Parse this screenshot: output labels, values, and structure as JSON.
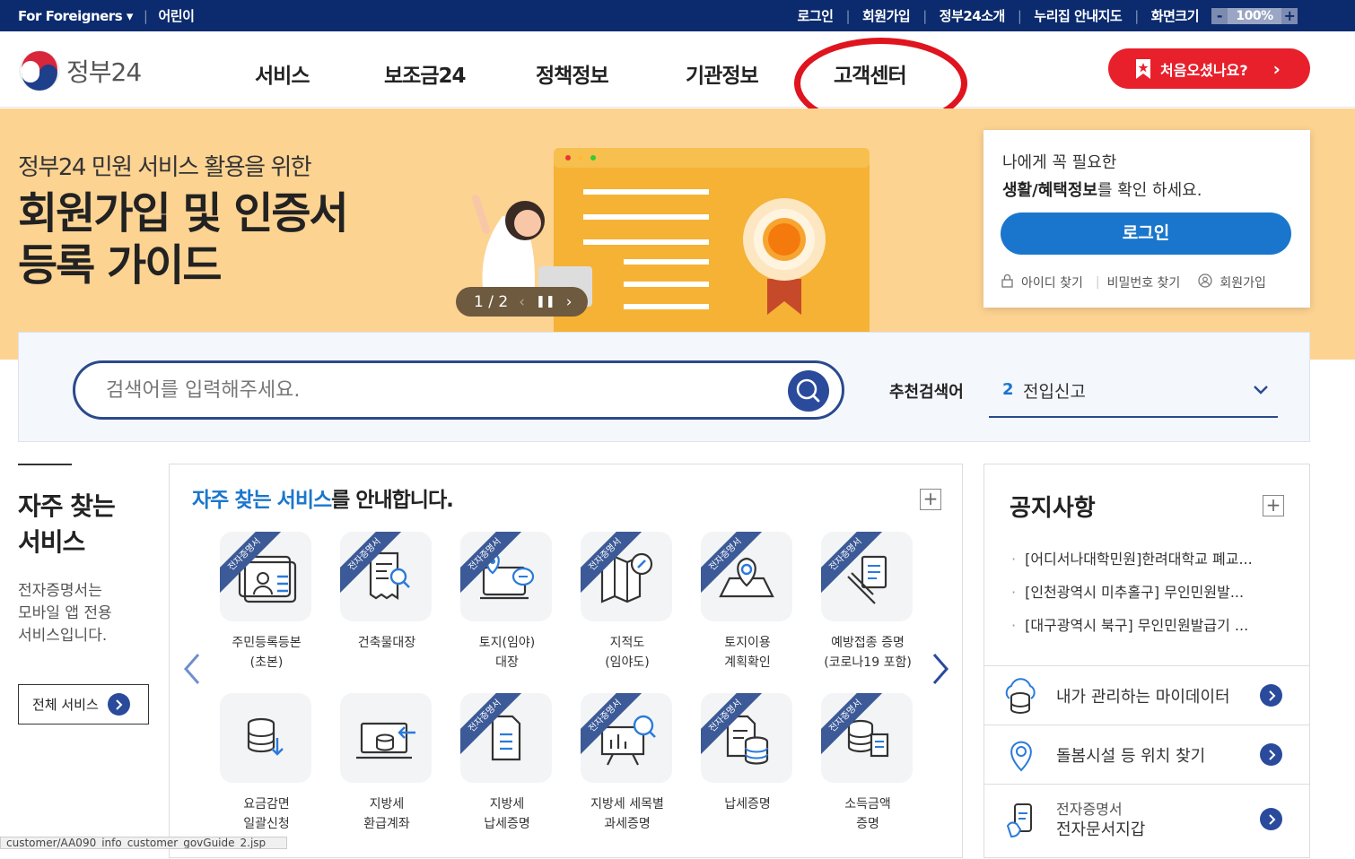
{
  "topbar": {
    "foreigners": "For Foreigners",
    "kids": "어린이",
    "login": "로그인",
    "signup": "회원가입",
    "intro": "정부24소개",
    "nurizip": "누리집 안내지도",
    "screen_size": "화면크기",
    "zoom_minus": "-",
    "zoom_value": "100%",
    "zoom_plus": "+"
  },
  "header": {
    "logo_text": "정부24",
    "nav": [
      "서비스",
      "보조금24",
      "정책정보",
      "기관정보",
      "고객센터"
    ],
    "first_visit": "처음오셨나요?"
  },
  "banner": {
    "subtitle": "정부24 민원 서비스 활용을 위한",
    "title_line1": "회원가입 및 인증서",
    "title_line2": "등록 가이드",
    "pager": "1 / 2"
  },
  "loginbox": {
    "line1": "나에게 꼭 필요한",
    "line2_bold": "생활/혜택정보",
    "line2_rest": "를 확인 하세요.",
    "login_button": "로그인",
    "find_id": "아이디 찾기",
    "find_pw": "비밀번호 찾기",
    "signup": "회원가입"
  },
  "search": {
    "placeholder": "검색어를 입력해주세요.",
    "recommend_label": "추천검색어",
    "recommend_num": "2",
    "recommend_text": "전입신고"
  },
  "frequent": {
    "title_line1": "자주 찾는",
    "title_line2": "서비스",
    "desc_line1": "전자증명서는",
    "desc_line2": "모바일 앱 전용",
    "desc_line3": "서비스입니다.",
    "all_services": "전체 서비스"
  },
  "services": {
    "head_highlight": "자주 찾는 서비스",
    "head_rest": "를 안내합니다.",
    "ribbon": "전자증명서",
    "row1": [
      {
        "l1": "주민등록등본",
        "l2": "(초본)",
        "icon": "id-card-icon"
      },
      {
        "l1": "건축물대장",
        "l2": "",
        "icon": "document-search-icon"
      },
      {
        "l1": "토지(임야)",
        "l2": "대장",
        "icon": "map-pin-chat-icon"
      },
      {
        "l1": "지적도",
        "l2": "(임야도)",
        "icon": "map-compass-icon"
      },
      {
        "l1": "토지이용",
        "l2": "계획확인",
        "icon": "land-pin-icon"
      },
      {
        "l1": "예방접종 증명",
        "l2": "(코로나19 포함)",
        "icon": "vaccine-icon"
      }
    ],
    "row2": [
      {
        "l1": "요금감면",
        "l2": "일괄신청",
        "icon": "database-download-icon"
      },
      {
        "l1": "지방세",
        "l2": "환급계좌",
        "icon": "refund-monitor-icon"
      },
      {
        "l1": "지방세",
        "l2": "납세증명",
        "icon": "tax-document-icon"
      },
      {
        "l1": "지방세 세목별",
        "l2": "과세증명",
        "icon": "chart-search-icon"
      },
      {
        "l1": "납세증명",
        "l2": "",
        "icon": "document-database-icon"
      },
      {
        "l1": "소득금액",
        "l2": "증명",
        "icon": "coins-document-icon"
      }
    ]
  },
  "notice": {
    "title": "공지사항",
    "items": [
      "[어디서나대학민원]한려대학교 폐교...",
      "[인천광역시 미추홀구] 무인민원발...",
      "[대구광역시 북구] 무인민원발급기 ..."
    ],
    "quick1": "내가 관리하는 마이데이터",
    "quick2": "돌봄시설 등 위치 찾기",
    "quick3_l1": "전자증명서",
    "quick3_l2": "전자문서지갑"
  },
  "status_url": "customer/AA090_info_customer_govGuide_2.jsp"
}
